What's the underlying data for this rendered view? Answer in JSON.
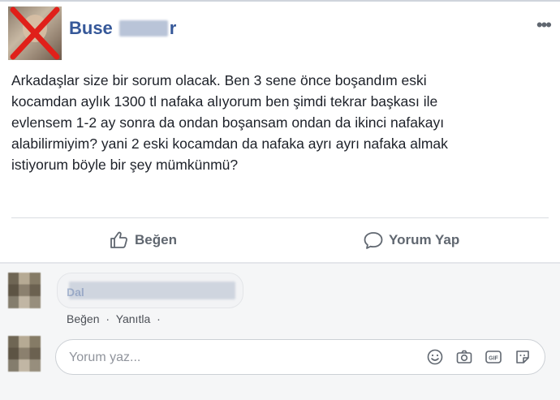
{
  "post": {
    "author_visible": "Buse",
    "author_suffix": "r",
    "more_label": "•••",
    "text_lines": [
      "Arkadaşlar size bir sorum olacak. Ben 3 sene önce boşandım eski",
      "kocamdan aylık 1300 tl nafaka alıyorum ben şimdi tekrar başkası ile",
      "evlensem 1-2 ay sonra da ondan boşansam ondan da ikinci nafakayı",
      "alabilirmiyim? yani 2 eski kocamdan da nafaka ayrı ayrı nafaka almak",
      "istiyorum böyle bir şey mümkünmü?"
    ]
  },
  "actions": {
    "like_label": "Beğen",
    "comment_label": "Yorum Yap"
  },
  "comment": {
    "name_initial": "Dal",
    "like_label": "Beğen",
    "separator": "·",
    "reply_label": "Yanıtla",
    "trail": "·"
  },
  "composer": {
    "placeholder": "Yorum yaz..."
  },
  "colors": {
    "link": "#365899",
    "text": "#1d2129",
    "muted": "#606770"
  }
}
